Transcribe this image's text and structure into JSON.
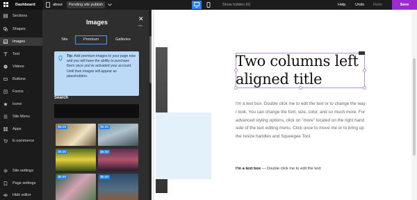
{
  "topbar": {
    "brand": "Dashboard",
    "page": "about",
    "status": "Pending site publish",
    "show_hidden": "Show hidden (0)",
    "help": "Help",
    "undo": "Undo",
    "redo": "Redo",
    "save": "Save"
  },
  "sidebar": {
    "items": [
      {
        "label": "Sections",
        "icon": "sections-icon"
      },
      {
        "label": "Shapes",
        "icon": "shapes-icon"
      },
      {
        "label": "Images",
        "icon": "image-icon",
        "active": true
      },
      {
        "label": "Text",
        "icon": "text-icon"
      },
      {
        "label": "Videos",
        "icon": "video-icon"
      },
      {
        "label": "Buttons",
        "icon": "button-icon"
      },
      {
        "label": "Forms",
        "icon": "form-icon"
      },
      {
        "label": "Icons",
        "icon": "star-icon"
      },
      {
        "label": "Site Menu",
        "icon": "menu-icon"
      },
      {
        "label": "Apps",
        "icon": "apps-icon"
      },
      {
        "label": "E-commerce",
        "icon": "cart-icon"
      }
    ],
    "bottom": [
      {
        "label": "Site settings",
        "icon": "gear-icon"
      },
      {
        "label": "Page settings",
        "icon": "page-settings-icon"
      },
      {
        "label": "Hide editor",
        "icon": "eye-icon"
      }
    ]
  },
  "panel": {
    "title": "Images",
    "close": "✕",
    "esc": "esc",
    "tabs": [
      "Site",
      "Premium",
      "Galleries"
    ],
    "active_tab": "Premium",
    "tip_label": "Tip:",
    "tip_text": "Add premium images to your page now and you will have the ability to purchase them once you've activated your account. Until then images will appear as placeholders.",
    "search_label": "Search",
    "search_value": "",
    "price": "$5.00"
  },
  "canvas": {
    "title": "Two columns left aligned title",
    "body": "I'm a text box. Double click me to edit the text or to change the way I look. You can change the font, size, color, and so much more. For advanced styling options, click on \"more\" located on the right hand side of the text editing menu. Click once to move me or to bring up the resize handles and Squeegee Tool.",
    "caption_bold": "I'm a text box",
    "caption_rest": "— Double click me to edit the text"
  },
  "colors": {
    "accent": "#2b83e5",
    "save": "#9b2bcf",
    "selection": "#b393d6",
    "tip_bg": "#bcd9f6"
  }
}
